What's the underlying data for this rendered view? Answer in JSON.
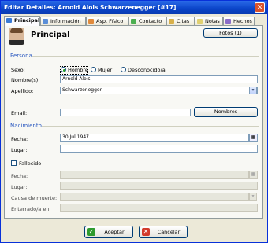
{
  "window": {
    "title": "Editar Detalles: Arnold Alois Schwarzenegger [#17]",
    "close_glyph": "✕"
  },
  "tabs": [
    {
      "label": "Principal",
      "icon": "person-icon",
      "color": "#3a7bd5"
    },
    {
      "label": "Información",
      "icon": "info-icon",
      "color": "#5b8fd8"
    },
    {
      "label": "Asp. Físico",
      "icon": "body-icon",
      "color": "#e08a3c"
    },
    {
      "label": "Contacto",
      "icon": "contact-icon",
      "color": "#4caf50"
    },
    {
      "label": "Citas",
      "icon": "appointments-icon",
      "color": "#d8b04a"
    },
    {
      "label": "Notas",
      "icon": "notes-icon",
      "color": "#e0d070"
    },
    {
      "label": "Hechos",
      "icon": "facts-icon",
      "color": "#8a6cc8"
    }
  ],
  "header": {
    "title": "Principal",
    "photos_button": "Fotos (1)"
  },
  "persona": {
    "group_label": "Persona",
    "sexo_label": "Sexo:",
    "sexo_options": [
      "Hombre",
      "Mujer",
      "Desconocido/a"
    ],
    "sexo_selected": "Hombre",
    "nombres_label": "Nombre(s):",
    "nombres_value": "Arnold Alois",
    "apellido_label": "Apellido:",
    "apellido_value": "Schwarzenegger",
    "email_label": "Email:",
    "email_value": "",
    "nombres_button": "Nombres"
  },
  "nacimiento": {
    "group_label": "Nacimiento",
    "fecha_label": "Fecha:",
    "fecha_value": "30 Jul 1947",
    "lugar_label": "Lugar:",
    "lugar_value": ""
  },
  "fallecido": {
    "checkbox_label": "Fallecido",
    "checked": false,
    "fecha_label": "Fecha:",
    "lugar_label": "Lugar:",
    "causa_label": "Causa de muerte:",
    "enterrado_label": "Enterrado/a en:"
  },
  "footer": {
    "accept": "Aceptar",
    "cancel": "Cancelar"
  },
  "colors": {
    "accent": "#2c5ac0",
    "titlebar": "#0a44c8",
    "accept_icon": "#2e9b2e",
    "cancel_icon": "#d23a2a"
  }
}
